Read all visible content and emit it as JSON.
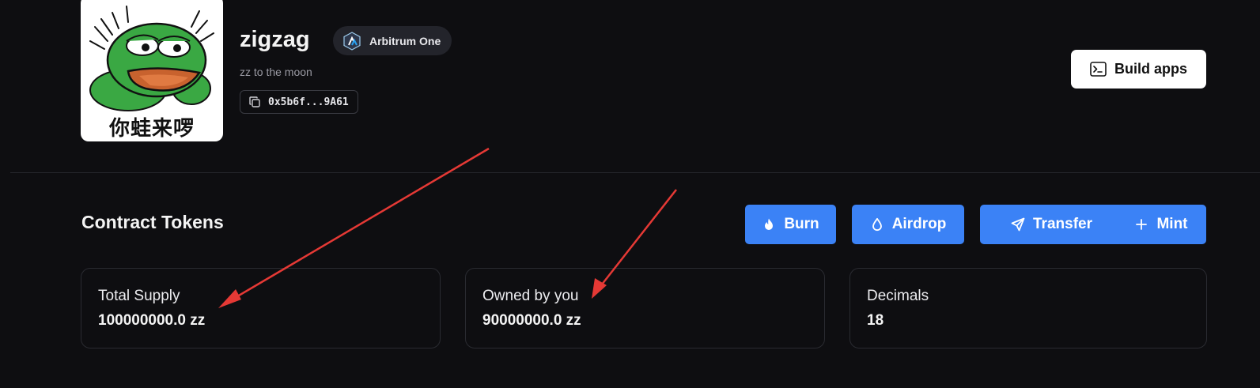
{
  "token": {
    "avatar_caption": "你蛙来啰",
    "name": "zigzag",
    "chain": "Arbitrum One",
    "description": "zz to the moon",
    "address": "0x5b6f...9A61"
  },
  "header": {
    "build_apps_label": "Build apps"
  },
  "section": {
    "title": "Contract Tokens",
    "actions": [
      {
        "label": "Burn",
        "icon": "flame-icon"
      },
      {
        "label": "Airdrop",
        "icon": "droplet-icon"
      },
      {
        "label": "Transfer",
        "icon": "send-icon"
      },
      {
        "label": "Mint",
        "icon": "plus-icon"
      }
    ],
    "stats": [
      {
        "label": "Total Supply",
        "value": "100000000.0 zz"
      },
      {
        "label": "Owned by you",
        "value": "90000000.0 zz"
      },
      {
        "label": "Decimals",
        "value": "18"
      }
    ]
  },
  "colors": {
    "background": "#0e0e11",
    "accent": "#3b82f6",
    "annotation": "#e53935"
  }
}
